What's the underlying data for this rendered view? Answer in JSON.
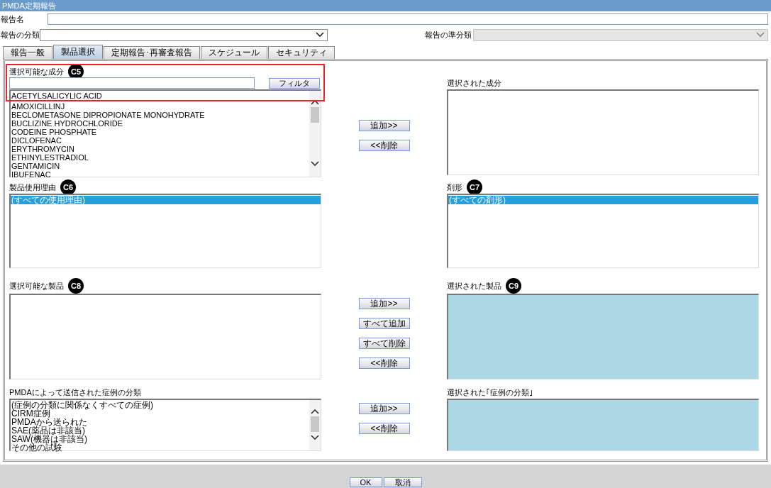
{
  "window": {
    "title": "PMDA定期報告"
  },
  "report_name": {
    "label": "報告名"
  },
  "report_category": {
    "label": "報告の分類",
    "disabled": false
  },
  "report_subcategory": {
    "label": "報告の準分類",
    "disabled": true
  },
  "tabs": [
    {
      "label": "報告一般",
      "selected": false
    },
    {
      "label": "製品選択",
      "selected": true
    },
    {
      "label": "定期報告･再審査報告",
      "selected": false
    },
    {
      "label": "スケジュール",
      "selected": false
    },
    {
      "label": "セキュリティ",
      "selected": false
    }
  ],
  "sections": [
    {
      "left": {
        "label": "選択可能な成分",
        "callout": "C5",
        "highlighted": true,
        "filter_button": "フィルタ",
        "scrollbar": true,
        "items": [
          {
            "text": "ACETYLSALICYLIC ACID",
            "selected": false
          },
          {
            "text": "AMOXICILLINJ",
            "selected": false
          },
          {
            "text": "BECLOMETASONE DIPROPIONATE MONOHYDRATE",
            "selected": false
          },
          {
            "text": "BUCLIZINE HYDROCHLORIDE",
            "selected": false
          },
          {
            "text": "CODEINE PHOSPHATE",
            "selected": false
          },
          {
            "text": "DICLOFENAC",
            "selected": false
          },
          {
            "text": "ERYTHROMYCIN",
            "selected": false
          },
          {
            "text": "ETHINYLESTRADIOL",
            "selected": false
          },
          {
            "text": "GENTAMICIN",
            "selected": false
          },
          {
            "text": "IBUFENAC",
            "selected": false
          }
        ]
      },
      "buttons": [
        "追加>>",
        "<<削除"
      ],
      "right": {
        "label": "選択された成分",
        "disabled": false
      }
    },
    {
      "left": {
        "label": "製品使用理由",
        "callout": "C6",
        "highlighted": false,
        "scrollbar": false,
        "items": [
          {
            "text": "(すべての使用理由)",
            "selected": true
          }
        ]
      },
      "right": {
        "label": "剤形",
        "callout": "C7",
        "disabled": false,
        "items": [
          {
            "text": "(すべての剤形)",
            "selected": true
          }
        ]
      }
    },
    {
      "left": {
        "label": "選択可能な製品",
        "callout": "C8",
        "highlighted": false,
        "scrollbar": false
      },
      "buttons": [
        "追加>>",
        "すべて追加",
        "すべて削除",
        "<<削除"
      ],
      "right": {
        "label": "選択された製品",
        "callout": "C9",
        "disabled": true
      }
    },
    {
      "left": {
        "label": "PMDAによって送信された症例の分類",
        "highlighted": false,
        "scrollbar": true,
        "items": [
          {
            "text": "(症例の分類に関係なくすべての症例)",
            "selected": false
          },
          {
            "text": "CIRM症例",
            "selected": false
          },
          {
            "text": "PMDAから送られた",
            "selected": false
          },
          {
            "text": "SAE(薬品は非該当)",
            "selected": false
          },
          {
            "text": "SAW(機器は非該当)",
            "selected": false
          },
          {
            "text": "その他の試験",
            "selected": false
          }
        ]
      },
      "buttons": [
        "追加>>",
        "<<削除"
      ],
      "right": {
        "label": "選択された｢症例の分類｣",
        "disabled": true
      }
    }
  ],
  "footer_buttons": [
    "OK",
    "取消"
  ]
}
